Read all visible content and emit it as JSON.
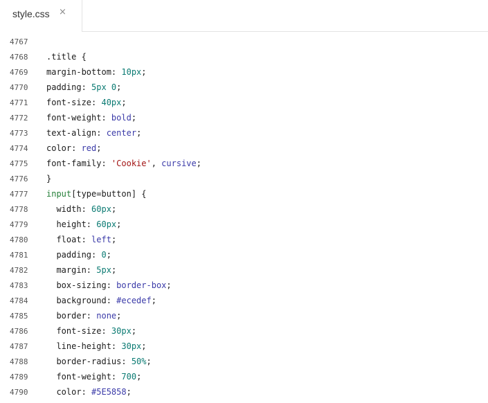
{
  "tab": {
    "label": "style.css",
    "close": "×"
  },
  "lines": [
    {
      "n": "4767",
      "parts": []
    },
    {
      "n": "4768",
      "parts": [
        {
          "t": ".title {",
          "c": "sel"
        }
      ]
    },
    {
      "n": "4769",
      "parts": [
        {
          "t": "margin-bottom: ",
          "c": "prop"
        },
        {
          "t": "10px",
          "c": "val"
        },
        {
          "t": ";",
          "c": "punct"
        }
      ]
    },
    {
      "n": "4770",
      "parts": [
        {
          "t": "padding: ",
          "c": "prop"
        },
        {
          "t": "5px 0",
          "c": "val"
        },
        {
          "t": ";",
          "c": "punct"
        }
      ]
    },
    {
      "n": "4771",
      "parts": [
        {
          "t": "font-size: ",
          "c": "prop"
        },
        {
          "t": "40px",
          "c": "val"
        },
        {
          "t": ";",
          "c": "punct"
        }
      ]
    },
    {
      "n": "4772",
      "parts": [
        {
          "t": "font-weight: ",
          "c": "prop"
        },
        {
          "t": "bold",
          "c": "kw"
        },
        {
          "t": ";",
          "c": "punct"
        }
      ]
    },
    {
      "n": "4773",
      "parts": [
        {
          "t": "text-align: ",
          "c": "prop"
        },
        {
          "t": "center",
          "c": "kw"
        },
        {
          "t": ";",
          "c": "punct"
        }
      ]
    },
    {
      "n": "4774",
      "parts": [
        {
          "t": "color: ",
          "c": "prop"
        },
        {
          "t": "red",
          "c": "kw"
        },
        {
          "t": ";",
          "c": "punct"
        }
      ]
    },
    {
      "n": "4775",
      "parts": [
        {
          "t": "font-family: ",
          "c": "prop"
        },
        {
          "t": "'Cookie'",
          "c": "str"
        },
        {
          "t": ", ",
          "c": "punct"
        },
        {
          "t": "cursive",
          "c": "kw"
        },
        {
          "t": ";",
          "c": "punct"
        }
      ]
    },
    {
      "n": "4776",
      "parts": [
        {
          "t": "}",
          "c": "punct"
        }
      ]
    },
    {
      "n": "4777",
      "parts": [
        {
          "t": "input",
          "c": "tag"
        },
        {
          "t": "[type=button] {",
          "c": "sel"
        }
      ]
    },
    {
      "n": "4778",
      "parts": [
        {
          "t": "  width: ",
          "c": "prop"
        },
        {
          "t": "60px",
          "c": "val"
        },
        {
          "t": ";",
          "c": "punct"
        }
      ]
    },
    {
      "n": "4779",
      "parts": [
        {
          "t": "  height: ",
          "c": "prop"
        },
        {
          "t": "60px",
          "c": "val"
        },
        {
          "t": ";",
          "c": "punct"
        }
      ]
    },
    {
      "n": "4780",
      "parts": [
        {
          "t": "  float: ",
          "c": "prop"
        },
        {
          "t": "left",
          "c": "kw"
        },
        {
          "t": ";",
          "c": "punct"
        }
      ]
    },
    {
      "n": "4781",
      "parts": [
        {
          "t": "  padding: ",
          "c": "prop"
        },
        {
          "t": "0",
          "c": "val"
        },
        {
          "t": ";",
          "c": "punct"
        }
      ]
    },
    {
      "n": "4782",
      "parts": [
        {
          "t": "  margin: ",
          "c": "prop"
        },
        {
          "t": "5px",
          "c": "val"
        },
        {
          "t": ";",
          "c": "punct"
        }
      ]
    },
    {
      "n": "4783",
      "parts": [
        {
          "t": "  box-sizing: ",
          "c": "prop"
        },
        {
          "t": "border-box",
          "c": "kw"
        },
        {
          "t": ";",
          "c": "punct"
        }
      ]
    },
    {
      "n": "4784",
      "parts": [
        {
          "t": "  background: ",
          "c": "prop"
        },
        {
          "t": "#ecedef",
          "c": "kw"
        },
        {
          "t": ";",
          "c": "punct"
        }
      ]
    },
    {
      "n": "4785",
      "parts": [
        {
          "t": "  border: ",
          "c": "prop"
        },
        {
          "t": "none",
          "c": "kw"
        },
        {
          "t": ";",
          "c": "punct"
        }
      ]
    },
    {
      "n": "4786",
      "parts": [
        {
          "t": "  font-size: ",
          "c": "prop"
        },
        {
          "t": "30px",
          "c": "val"
        },
        {
          "t": ";",
          "c": "punct"
        }
      ]
    },
    {
      "n": "4787",
      "parts": [
        {
          "t": "  line-height: ",
          "c": "prop"
        },
        {
          "t": "30px",
          "c": "val"
        },
        {
          "t": ";",
          "c": "punct"
        }
      ]
    },
    {
      "n": "4788",
      "parts": [
        {
          "t": "  border-radius: ",
          "c": "prop"
        },
        {
          "t": "50%",
          "c": "val"
        },
        {
          "t": ";",
          "c": "punct"
        }
      ]
    },
    {
      "n": "4789",
      "parts": [
        {
          "t": "  font-weight: ",
          "c": "prop"
        },
        {
          "t": "700",
          "c": "val"
        },
        {
          "t": ";",
          "c": "punct"
        }
      ]
    },
    {
      "n": "4790",
      "parts": [
        {
          "t": "  color: ",
          "c": "prop"
        },
        {
          "t": "#5E5858",
          "c": "kw"
        },
        {
          "t": ";",
          "c": "punct"
        }
      ]
    }
  ]
}
